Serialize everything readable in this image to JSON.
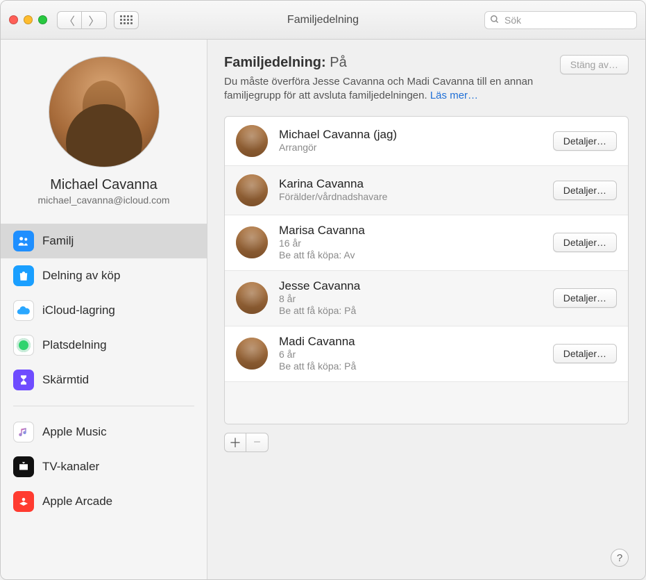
{
  "window": {
    "title": "Familjedelning"
  },
  "search": {
    "placeholder": "Sök"
  },
  "user": {
    "name": "Michael Cavanna",
    "email": "michael_cavanna@icloud.com"
  },
  "sidebar": {
    "items": [
      {
        "label": "Familj"
      },
      {
        "label": "Delning av köp"
      },
      {
        "label": "iCloud-lagring"
      },
      {
        "label": "Platsdelning"
      },
      {
        "label": "Skärmtid"
      },
      {
        "label": "Apple Music"
      },
      {
        "label": "TV-kanaler"
      },
      {
        "label": "Apple Arcade"
      }
    ]
  },
  "header": {
    "label": "Familjedelning:",
    "status": "På",
    "turn_off": "Stäng av…",
    "subtext": "Du måste överföra Jesse Cavanna och Madi Cavanna till en annan familjegrupp för att avsluta familjedelningen.",
    "learn_more": "Läs mer…"
  },
  "buttons": {
    "details": "Detaljer…"
  },
  "members": [
    {
      "name": "Michael Cavanna (jag)",
      "role": "Arrangör",
      "extra": ""
    },
    {
      "name": "Karina Cavanna",
      "role": "Förälder/vårdnadshavare",
      "extra": ""
    },
    {
      "name": "Marisa Cavanna",
      "role": "16 år",
      "extra": "Be att få köpa: Av"
    },
    {
      "name": "Jesse Cavanna",
      "role": "8 år",
      "extra": "Be att få köpa: På"
    },
    {
      "name": "Madi Cavanna",
      "role": "6 år",
      "extra": "Be att få köpa: På"
    }
  ]
}
